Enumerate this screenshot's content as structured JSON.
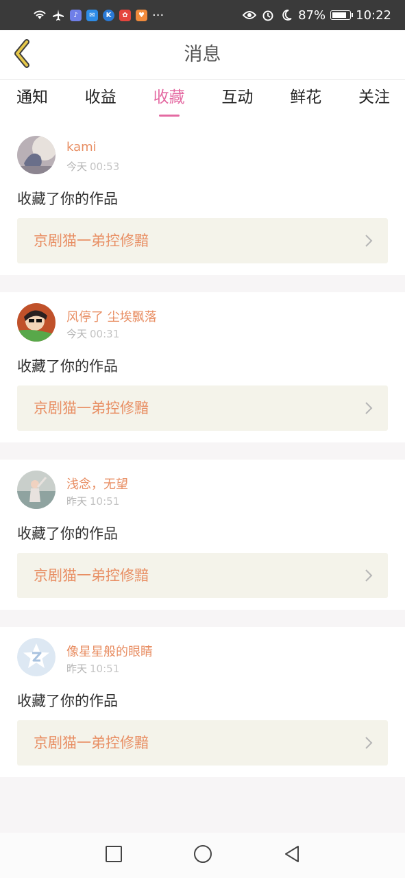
{
  "status_bar": {
    "battery": "87%",
    "time": "10:22",
    "more": "···",
    "icons": [
      "wifi-icon",
      "airplane-icon",
      "music-app-icon",
      "mail-app-icon",
      "kugou-app-icon",
      "huawei-app-icon",
      "heart-app-icon",
      "eye-icon",
      "alarm-icon",
      "moon-icon",
      "battery-icon"
    ]
  },
  "header": {
    "title": "消息",
    "back_icon": "chevron-left-icon",
    "accent": "#e6c84a"
  },
  "tabs": [
    {
      "label": "通知",
      "active": false
    },
    {
      "label": "收益",
      "active": false
    },
    {
      "label": "收藏",
      "active": true
    },
    {
      "label": "互动",
      "active": false
    },
    {
      "label": "鲜花",
      "active": false
    },
    {
      "label": "关注",
      "active": false
    }
  ],
  "messages": [
    {
      "user": "kami",
      "day": "今天",
      "time": "00:53",
      "action": "收藏了你的作品",
      "work": "京剧猫一弟控修黯"
    },
    {
      "user": "风停了 尘埃飘落",
      "day": "今天",
      "time": "00:31",
      "action": "收藏了你的作品",
      "work": "京剧猫一弟控修黯"
    },
    {
      "user": "浅念，无望",
      "day": "昨天",
      "time": "10:51",
      "action": "收藏了你的作品",
      "work": "京剧猫一弟控修黯"
    },
    {
      "user": "像星星般的眼睛",
      "day": "昨天",
      "time": "10:51",
      "action": "收藏了你的作品",
      "work": "京剧猫一弟控修黯"
    }
  ],
  "colors": {
    "tab_active": "#e46aa2",
    "username": "#e88e63",
    "work_bg": "#f4f3ea"
  }
}
